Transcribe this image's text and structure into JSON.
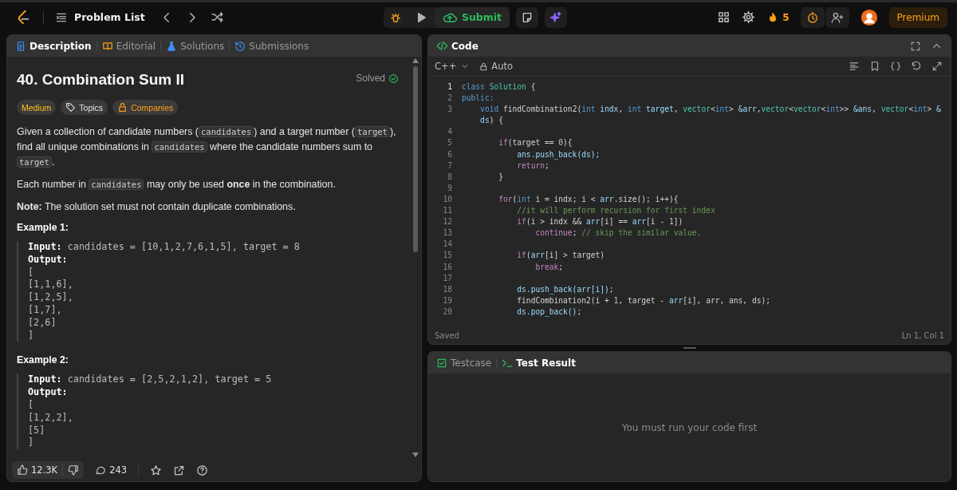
{
  "top_bar": {
    "title": "Problem List",
    "submit": "Submit",
    "streak": "5",
    "premium": "Premium"
  },
  "description_panel": {
    "tabs": [
      {
        "label": "Description",
        "selected": true
      },
      {
        "label": "Editorial",
        "selected": false
      },
      {
        "label": "Solutions",
        "selected": false
      },
      {
        "label": "Submissions",
        "selected": false
      }
    ],
    "title": "40. Combination Sum II",
    "status": "Solved",
    "tags": [
      {
        "label": "Medium",
        "kind": "difficulty"
      },
      {
        "label": "Topics",
        "kind": "topics"
      },
      {
        "label": "Companies",
        "kind": "companies"
      }
    ],
    "paragraphs": [
      [
        {
          "kind": "text",
          "text": "Given a collection of candidate numbers ("
        },
        {
          "kind": "code",
          "text": "candidates"
        },
        {
          "kind": "text",
          "text": ") and a target number ("
        },
        {
          "kind": "code",
          "text": "target"
        },
        {
          "kind": "text",
          "text": "), find all unique combinations in "
        },
        {
          "kind": "code",
          "text": "candidates"
        },
        {
          "kind": "text",
          "text": " where the candidate numbers sum to "
        },
        {
          "kind": "code",
          "text": "target"
        },
        {
          "kind": "text",
          "text": "."
        }
      ],
      [
        {
          "kind": "text",
          "text": "Each number in "
        },
        {
          "kind": "code",
          "text": "candidates"
        },
        {
          "kind": "text",
          "text": " may only be used **once** in the combination."
        }
      ],
      [
        {
          "kind": "text",
          "text": "**Note:** The solution set must not contain duplicate combinations."
        }
      ]
    ],
    "examples": [
      {
        "title": "Example 1:",
        "input_label": "Input:",
        "input": "candidates = [10,1,2,7,6,1,5], target = 8",
        "output_label": "Output:",
        "output_lines": [
          "[",
          "[1,1,6],",
          "[1,2,5],",
          "[1,7],",
          "[2,6]",
          "]"
        ]
      },
      {
        "title": "Example 2:",
        "input_label": "Input:",
        "input": "candidates = [2,5,2,1,2], target = 5",
        "output_label": "Output:",
        "output_lines": [
          "[",
          "[1,2,2],",
          "[5]",
          "]"
        ]
      }
    ],
    "footer": {
      "likes": "12.3K",
      "comments": "243"
    }
  },
  "code_panel": {
    "title": "Code",
    "language": "C++",
    "mode": "Auto",
    "lines": [
      {
        "number": "1",
        "tokens": [
          {
            "kind": "storage",
            "text": "class"
          },
          {
            "kind": "type",
            "text": " Solution"
          },
          {
            "kind": "plain",
            "text": " {"
          }
        ]
      },
      {
        "number": "2",
        "tokens": [
          {
            "kind": "storage",
            "text": "public:"
          }
        ]
      },
      {
        "number": "3",
        "tokens": [
          {
            "kind": "storage",
            "text": "    void"
          },
          {
            "kind": "plain",
            "text": " findCombination2("
          },
          {
            "kind": "storage",
            "text": "int"
          },
          {
            "kind": "var",
            "text": " indx"
          },
          {
            "kind": "plain",
            "text": ", "
          },
          {
            "kind": "storage",
            "text": "int"
          },
          {
            "kind": "var",
            "text": " target"
          },
          {
            "kind": "plain",
            "text": ", "
          },
          {
            "kind": "type",
            "text": "vector"
          },
          {
            "kind": "plain",
            "text": "<"
          },
          {
            "kind": "storage",
            "text": "int"
          },
          {
            "kind": "plain",
            "text": "> "
          },
          {
            "kind": "var",
            "text": "&arr"
          },
          {
            "kind": "plain",
            "text": ","
          },
          {
            "kind": "type",
            "text": "vector"
          },
          {
            "kind": "plain",
            "text": "<"
          },
          {
            "kind": "type",
            "text": "vector"
          },
          {
            "kind": "plain",
            "text": "<"
          },
          {
            "kind": "storage",
            "text": "int"
          },
          {
            "kind": "plain",
            "text": ">> "
          },
          {
            "kind": "var",
            "text": "&ans"
          },
          {
            "kind": "plain",
            "text": ", "
          },
          {
            "kind": "type",
            "text": "vector"
          },
          {
            "kind": "plain",
            "text": "<"
          },
          {
            "kind": "storage",
            "text": "int"
          },
          {
            "kind": "plain",
            "text": "> "
          },
          {
            "kind": "var",
            "text": "&"
          }
        ],
        "wrap_tokens": [
          {
            "kind": "var",
            "text": "    ds"
          },
          {
            "kind": "plain",
            "text": ") {"
          }
        ]
      },
      {
        "number": "4"
      },
      {
        "number": "5",
        "tokens": [
          {
            "kind": "keyword",
            "text": "        if"
          },
          {
            "kind": "plain",
            "text": "(target == "
          },
          {
            "kind": "number",
            "text": "0"
          },
          {
            "kind": "plain",
            "text": "){"
          }
        ]
      },
      {
        "number": "6",
        "tokens": [
          {
            "kind": "var",
            "text": "            ans.push_back(ds);"
          }
        ]
      },
      {
        "number": "7",
        "tokens": [
          {
            "kind": "keyword",
            "text": "            return"
          },
          {
            "kind": "plain",
            "text": ";"
          }
        ]
      },
      {
        "number": "8",
        "tokens": [
          {
            "kind": "plain",
            "text": "        }"
          }
        ]
      },
      {
        "number": "9"
      },
      {
        "number": "10",
        "tokens": [
          {
            "kind": "keyword",
            "text": "        for"
          },
          {
            "kind": "plain",
            "text": "("
          },
          {
            "kind": "storage",
            "text": "int"
          },
          {
            "kind": "plain",
            "text": " i = indx; i < "
          },
          {
            "kind": "var",
            "text": "arr"
          },
          {
            "kind": "plain",
            "text": ".size(); i++){"
          }
        ]
      },
      {
        "number": "11",
        "tokens": [
          {
            "kind": "comment",
            "text": "            //it will perform recursion for first index"
          }
        ]
      },
      {
        "number": "12",
        "tokens": [
          {
            "kind": "keyword",
            "text": "            if"
          },
          {
            "kind": "plain",
            "text": "(i > indx && "
          },
          {
            "kind": "var",
            "text": "arr"
          },
          {
            "kind": "plain",
            "text": "[i] == "
          },
          {
            "kind": "var",
            "text": "arr"
          },
          {
            "kind": "plain",
            "text": "[i - "
          },
          {
            "kind": "number",
            "text": "1"
          },
          {
            "kind": "plain",
            "text": "])"
          }
        ]
      },
      {
        "number": "13",
        "tokens": [
          {
            "kind": "keyword",
            "text": "                continue"
          },
          {
            "kind": "plain",
            "text": "; "
          },
          {
            "kind": "comment",
            "text": "// skip the similar value."
          }
        ]
      },
      {
        "number": "14"
      },
      {
        "number": "15",
        "tokens": [
          {
            "kind": "keyword",
            "text": "            if"
          },
          {
            "kind": "plain",
            "text": "("
          },
          {
            "kind": "var",
            "text": "arr"
          },
          {
            "kind": "plain",
            "text": "[i] > target)"
          }
        ]
      },
      {
        "number": "16",
        "tokens": [
          {
            "kind": "keyword",
            "text": "                break"
          },
          {
            "kind": "plain",
            "text": ";"
          }
        ]
      },
      {
        "number": "17"
      },
      {
        "number": "18",
        "tokens": [
          {
            "kind": "var",
            "text": "            ds.push_back(arr[i]);"
          }
        ]
      },
      {
        "number": "19",
        "tokens": [
          {
            "kind": "plain",
            "text": "            findCombination2(i + "
          },
          {
            "kind": "number",
            "text": "1"
          },
          {
            "kind": "plain",
            "text": ", target - "
          },
          {
            "kind": "var",
            "text": "arr"
          },
          {
            "kind": "plain",
            "text": "[i], arr, ans, ds);"
          }
        ]
      },
      {
        "number": "20",
        "tokens": [
          {
            "kind": "var",
            "text": "            ds.pop_back();"
          }
        ]
      }
    ],
    "status": "Saved",
    "cursor": "Ln 1, Col 1"
  },
  "result_panel": {
    "tabs": [
      {
        "label": "Testcase",
        "selected": false
      },
      {
        "label": "Test Result",
        "selected": true
      }
    ],
    "message": "You must run your code first"
  }
}
